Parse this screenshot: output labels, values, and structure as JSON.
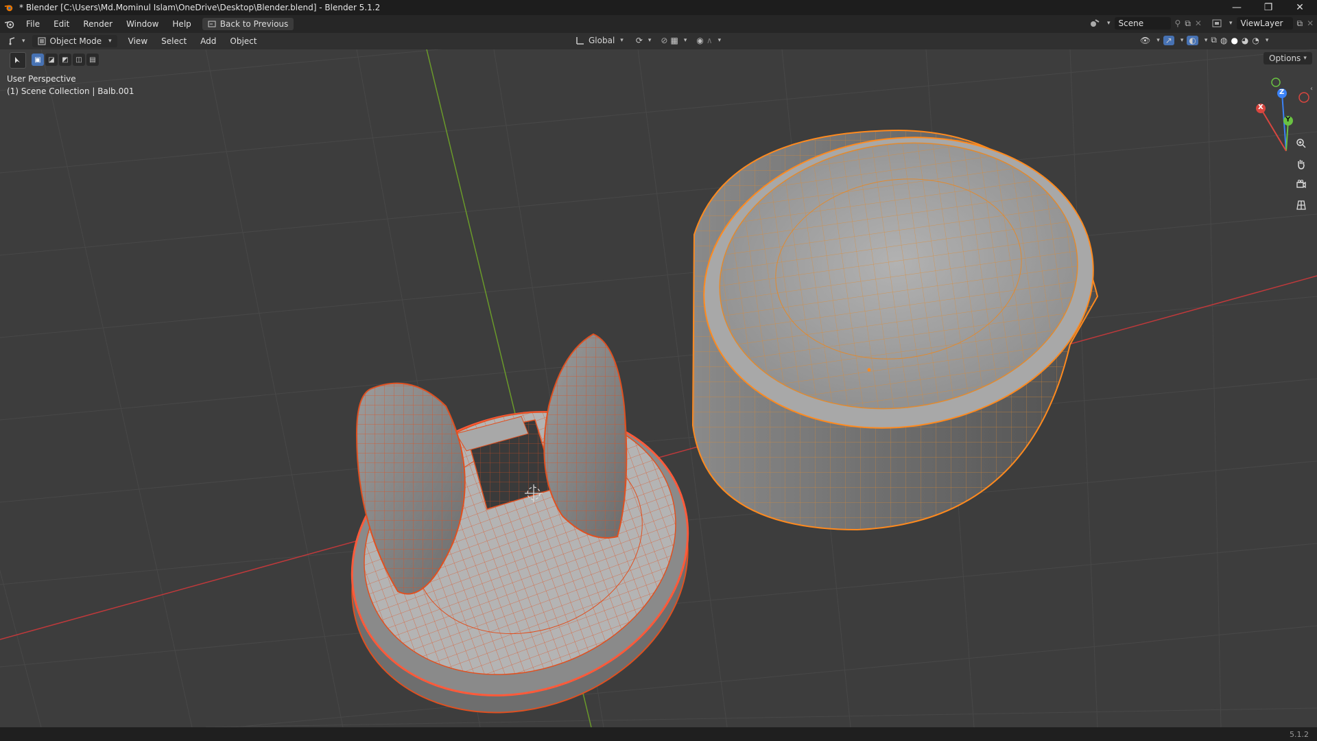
{
  "window": {
    "title": "* Blender [C:\\Users\\Md.Mominul Islam\\OneDrive\\Desktop\\Blender.blend] - Blender 5.1.2",
    "controls": [
      "minimize",
      "restore",
      "close"
    ]
  },
  "menubar": {
    "items": [
      "File",
      "Edit",
      "Render",
      "Window",
      "Help"
    ],
    "back_button": "Back to Previous",
    "scene_label": "Scene",
    "view_layer_label": "ViewLayer"
  },
  "header": {
    "mode": "Object Mode",
    "menus": [
      "View",
      "Select",
      "Add",
      "Object"
    ],
    "transform_orientation": "Global",
    "options_label": "Options"
  },
  "viewport": {
    "perspective_label": "User Perspective",
    "collection_label": "(1) Scene Collection | Balb.001",
    "gizmo": {
      "z": "Z",
      "y": "Y",
      "x": "X"
    }
  },
  "statusbar": {
    "version": "5.1.2"
  },
  "colors": {
    "viewport_bg": "#3d3d3d",
    "grid": "#484848",
    "x_axis": "#c0393b",
    "y_axis": "#6a9a2a",
    "selection_active": "#ff8a1e",
    "selection": "#e0551e",
    "mesh_face": "#9a9a9a"
  }
}
